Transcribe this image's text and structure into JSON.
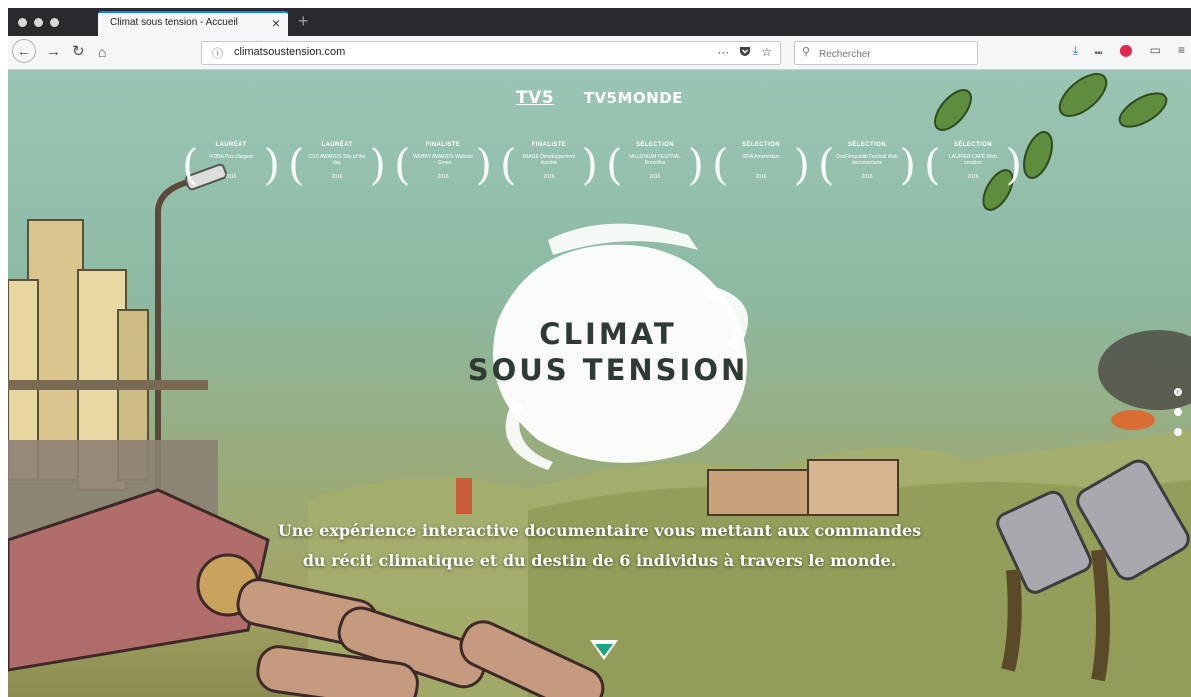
{
  "browser": {
    "tab_title": "Climat sous tension - Accueil",
    "tab_close": "×",
    "new_tab": "+",
    "url": "climatsoustension.com",
    "url_info_icon": "ⓘ",
    "url_actions": [
      "···",
      "pocket-icon",
      "☆"
    ],
    "search_placeholder": "Rechercher",
    "toolbar_icons": [
      "download-icon",
      "library-icon",
      "ublock-icon",
      "sidebar-icon",
      "menu-icon"
    ]
  },
  "page": {
    "brands": [
      "TV5",
      "TV5MONDE"
    ],
    "awards": [
      {
        "title": "LAURÉAT",
        "name": "FIDBA Prix d'argent",
        "year": "2016"
      },
      {
        "title": "LAURÉAT",
        "name": "CSS AWARDS Site of the day",
        "year": "2016"
      },
      {
        "title": "FINALISTE",
        "name": "WEBBY AWARDS Website - Green",
        "year": "2016"
      },
      {
        "title": "FINALISTE",
        "name": "IMAGE Développement durable",
        "year": "2016"
      },
      {
        "title": "SÉLECTION",
        "name": "MILLENIUM FESTIVAL Bruxelles",
        "year": "2016"
      },
      {
        "title": "SÉLECTION",
        "name": "IDFA Amsterdam",
        "year": "2016"
      },
      {
        "title": "SÉLECTION",
        "name": "DocFilmpublik Festival Web documentaire",
        "year": "2016"
      },
      {
        "title": "SÉLECTION",
        "name": "LAURIER CAFÉ Web creation",
        "year": "2016"
      }
    ],
    "logo_line1": "CLIMAT",
    "logo_line2": "SOUS TENSION",
    "tagline_line1": "Une expérience interactive documentaire vous mettant aux commandes",
    "tagline_line2": "du récit climatique et du destin de 6 individus à travers le monde.",
    "pagination_count": 3,
    "pagination_active": 1,
    "colors": {
      "sky": "#9ac5b4",
      "accent": "#19a67e",
      "text": "#ffffff"
    }
  }
}
